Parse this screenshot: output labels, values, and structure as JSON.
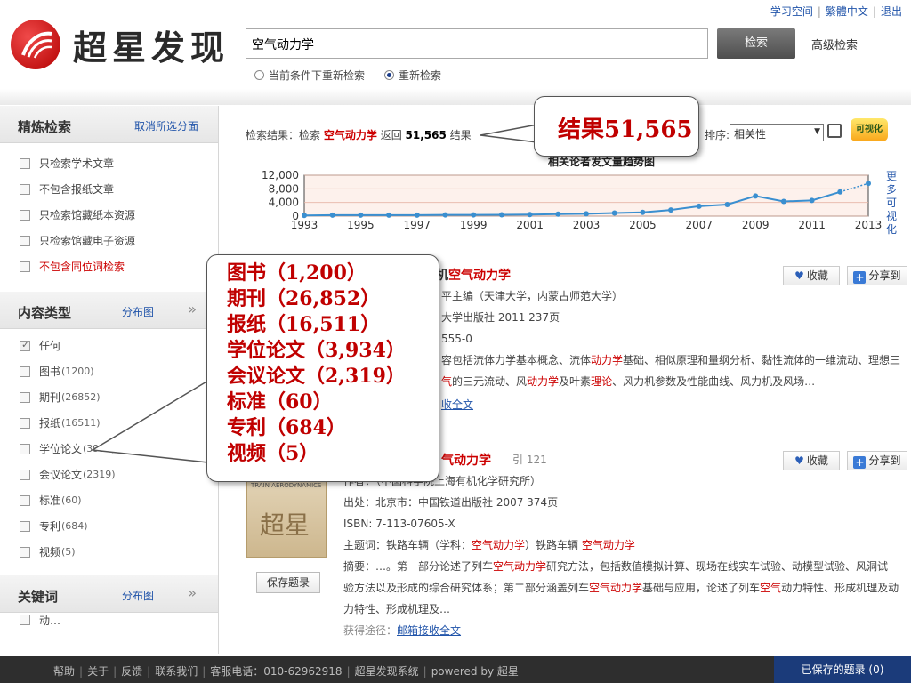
{
  "header": {
    "logo_text": "超星发现",
    "top_links": [
      "学习空间",
      "繁體中文",
      "退出"
    ],
    "search_value": "空气动力学",
    "search_button": "检索",
    "advanced_search": "高级检索",
    "radio_options": [
      {
        "label": "当前条件下重新检索",
        "checked": false
      },
      {
        "label": "重新检索",
        "checked": true
      }
    ]
  },
  "sidebar": {
    "refine": {
      "title": "精炼检索",
      "action": "取消所选分面",
      "options": [
        "只检索学术文章",
        "不包含报纸文章",
        "只检索馆藏纸本资源",
        "只检索馆藏电子资源",
        "不包含同位词检索"
      ]
    },
    "content_type": {
      "title": "内容类型",
      "action": "分布图",
      "options": [
        {
          "label": "任何",
          "count": ""
        },
        {
          "label": "图书",
          "count": "(1200)"
        },
        {
          "label": "期刊",
          "count": "(26852)"
        },
        {
          "label": "报纸",
          "count": "(16511)"
        },
        {
          "label": "学位论文",
          "count": "(3934)"
        },
        {
          "label": "会议论文",
          "count": "(2319)"
        },
        {
          "label": "标准",
          "count": "(60)"
        },
        {
          "label": "专利",
          "count": "(684)"
        },
        {
          "label": "视频",
          "count": "(5)"
        }
      ]
    },
    "keywords": {
      "title": "关键词",
      "action": "分布图",
      "first_item": "动…"
    }
  },
  "results": {
    "summary_prefix": "检索结果：检索",
    "summary_keyword": "空气动力学",
    "summary_mid": "返回",
    "summary_count": "51,565",
    "summary_suffix": "结果",
    "sort_label": "排序:",
    "sort_value": "相关性",
    "viz_label": "可视化",
    "chart_title": "相关论者发文量趋势图",
    "chart_more": "更多可视化",
    "items": [
      {
        "title_prefix": "…机",
        "title_kw": "空气动力学",
        "author": "平主编（天津大学，内蒙古师范大学）",
        "publisher": "大学出版社 2011 237页",
        "isbn": "555-0",
        "abstract_1a": "容包括流体力学基本概念、流体",
        "abstract_1b": "动力学",
        "abstract_1c": "基础、相似原理和量纲分析、黏性流体的一维流动、理想三",
        "abstract_2a": "气",
        "abstract_2b": "的三元流动、风",
        "abstract_2c": "动力学",
        "abstract_2d": "及叶素",
        "abstract_2e": "理论",
        "abstract_2f": "、风力机参数及性能曲线、风力机及风场…",
        "access": "收全文",
        "fav": "收藏",
        "share": "分享到"
      },
      {
        "title_kw": "气动力学",
        "cite": "引 121",
        "author": "作者：（中国科学院上海有机化学研究所）",
        "publisher": "出处：北京市：中国铁道出版社 2007 374页",
        "isbn": "ISBN: 7-113-07605-X",
        "subject_prefix": "主题词：铁路车辆（学科：",
        "subject_kw1": "空气动力学",
        "subject_mid": "）铁路车辆",
        "subject_kw2": "空气动力学",
        "abstract_1a": "摘要：…。第一部分论述了列车",
        "abstract_1b": "空气动力学",
        "abstract_1c": "研究方法，包括数值模拟计算、现场在线实车试验、动模型试验、风洞试",
        "abstract_2a": "验方法以及形成的综合研究体系；第二部分涵盖列车",
        "abstract_2b": "空气动力学",
        "abstract_2c": "基础与应用，论述了列车",
        "abstract_2d": "空气",
        "abstract_2e": "动力特性、形成机理及动",
        "abstract_3": "力特性、形成机理及…",
        "access_label": "获得途径：",
        "access_link": "邮箱接收全文",
        "fav": "收藏",
        "share": "分享到",
        "save": "保存题录",
        "cover_caption": "TRAIN AERODYNAMICS",
        "cover_glyph": "超星"
      }
    ]
  },
  "chart_data": {
    "type": "line",
    "title": "相关论者发文量趋势图",
    "x": [
      1993,
      1994,
      1995,
      1996,
      1997,
      1998,
      1999,
      2000,
      2001,
      2002,
      2003,
      2004,
      2005,
      2006,
      2007,
      2008,
      2009,
      2010,
      2011,
      2012,
      2013
    ],
    "values": [
      200,
      300,
      300,
      300,
      300,
      350,
      350,
      400,
      450,
      600,
      700,
      900,
      1100,
      1800,
      2900,
      3400,
      5900,
      4300,
      4600,
      7100,
      9600
    ],
    "x_ticks": [
      "1993",
      "1995",
      "1997",
      "1999",
      "2001",
      "2003",
      "2005",
      "2007",
      "2009",
      "2011",
      "2013"
    ],
    "y_ticks": [
      "0",
      "4,000",
      "8,000",
      "12,000"
    ],
    "ylim": [
      0,
      12000
    ],
    "line_color": "#3a8fd0"
  },
  "callouts": {
    "small": "结果51,565",
    "big_lines": [
      "图书（1,200）",
      "期刊（26,852）",
      "报纸（16,511）",
      "学位论文（3,934）",
      "会议论文（2,319）",
      "标准（60）",
      "专利（684）",
      "视频（5）"
    ]
  },
  "footer": {
    "links": [
      "帮助",
      "关于",
      "反馈",
      "联系我们",
      "客服电话：010-62962918",
      "超星发现系统",
      "powered by 超星"
    ],
    "saved": "已保存的题录 (0)"
  }
}
